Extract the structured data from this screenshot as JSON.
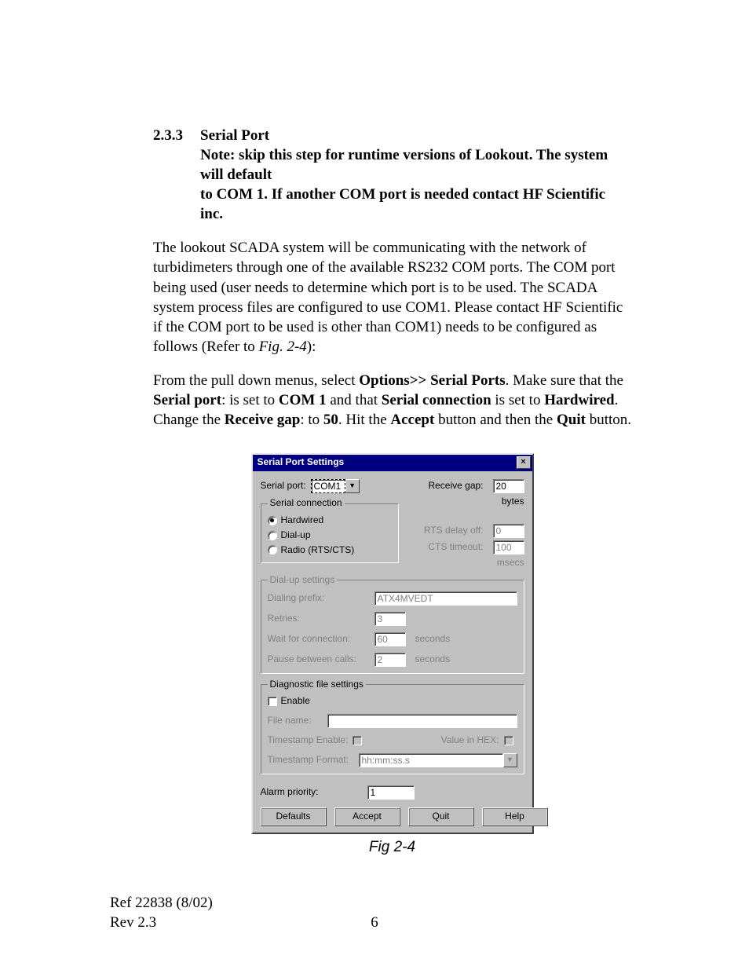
{
  "doc": {
    "section_number": "2.3.3",
    "section_title": "Serial Port",
    "note_line1": "Note: skip this step for runtime versions of Lookout. The system will default",
    "note_line2": "to COM 1. If another COM port is needed contact HF Scientific inc.",
    "para1": "The lookout SCADA system will be communicating with the network of turbidimeters through one of the available RS232 COM ports. The COM port being used (user needs to determine which port is to be used. The SCADA system process files are configured to use COM1. Please contact HF Scientific if the COM port to be used is other than COM1) needs to be configured as follows (Refer to ",
    "para1_figref": "Fig. 2-4",
    "para1_tail": "):",
    "para2_a": "From the pull down menus, select ",
    "para2_b": "Options>> Serial Ports",
    "para2_c": ". Make sure that the ",
    "para2_d": "Serial port",
    "para2_e": ": is set to ",
    "para2_f": "COM 1",
    "para2_g": " and that ",
    "para2_h": "Serial connection",
    "para2_i": " is set to ",
    "para2_j": "Hardwired",
    "para2_k": ". Change the ",
    "para2_l": "Receive gap",
    "para2_m": ": to ",
    "para2_n": "50",
    "para2_o": ". Hit the ",
    "para2_p": "Accept",
    "para2_q": " button and then the ",
    "para2_r": "Quit",
    "para2_s": " button.",
    "fig_caption": "Fig 2-4",
    "footer_ref": "Ref 22838 (8/02)",
    "footer_rev": "Rev 2.3",
    "page_number": "6"
  },
  "dialog": {
    "title": "Serial Port Settings",
    "labels": {
      "serial_port": "Serial port:",
      "receive_gap": "Receive gap:",
      "bytes": "bytes",
      "serial_connection": "Serial connection",
      "hardwired": "Hardwired",
      "dialup": "Dial-up",
      "radio": "Radio (RTS/CTS)",
      "rts_delay_off": "RTS delay off:",
      "cts_timeout": "CTS timeout:",
      "msecs": "msecs",
      "dialup_settings": "Dial-up settings",
      "dialing_prefix": "Dialing prefix:",
      "retries": "Retries:",
      "wait_conn": "Wait for connection:",
      "pause_between": "Pause between calls:",
      "seconds": "seconds",
      "diag_settings": "Diagnostic file settings",
      "enable": "Enable",
      "file_name": "File name:",
      "ts_enable": "Timestamp Enable:",
      "value_hex": "Value in HEX:",
      "ts_format": "Timestamp Format:",
      "alarm_priority": "Alarm priority:"
    },
    "values": {
      "serial_port": "COM1",
      "receive_gap": "20",
      "rts_delay_off": "0",
      "cts_timeout": "100",
      "dialing_prefix": "ATX4MVEDT",
      "retries": "3",
      "wait_conn": "60",
      "pause_between": "2",
      "ts_format": "hh:mm:ss.s",
      "alarm_priority": "1",
      "file_name": ""
    },
    "buttons": {
      "defaults": "Defaults",
      "accept": "Accept",
      "quit": "Quit",
      "help": "Help"
    }
  }
}
